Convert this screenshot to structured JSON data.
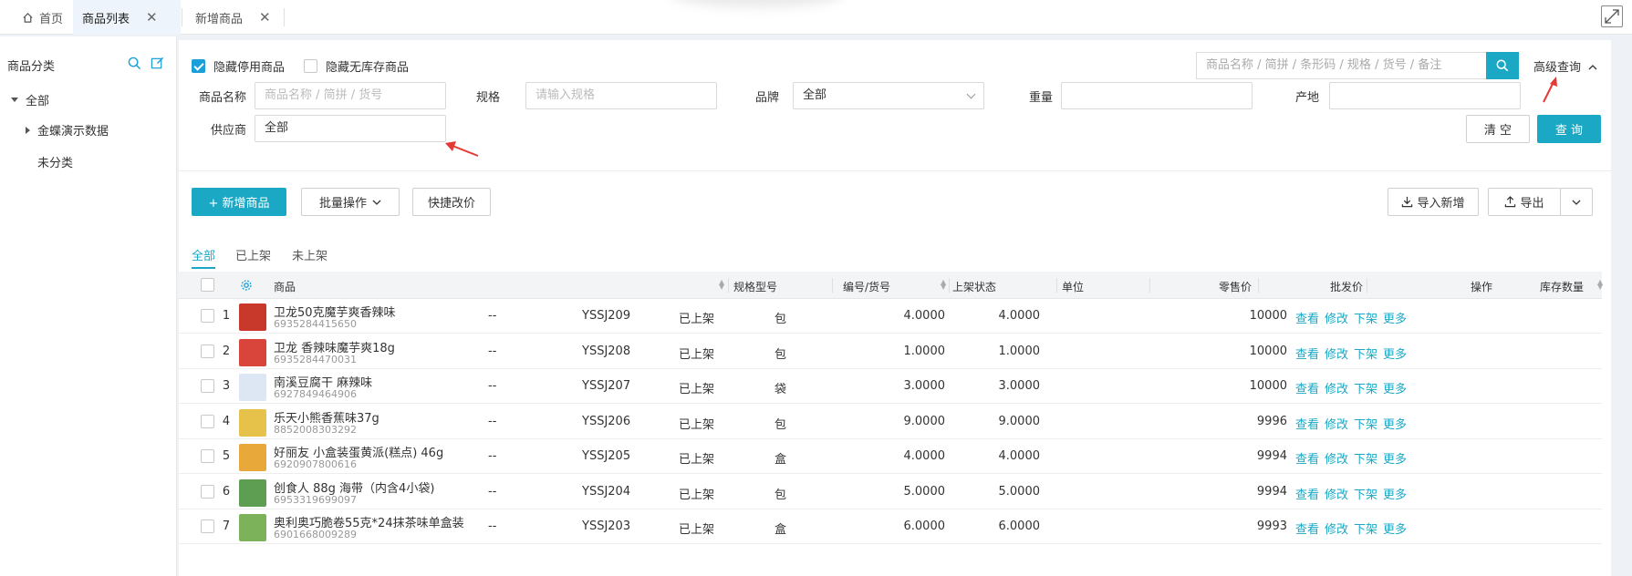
{
  "tabs": [
    {
      "label": "首页",
      "icon": "home-icon"
    },
    {
      "label": "商品列表",
      "closable": true,
      "active": true
    },
    {
      "label": "新增商品",
      "closable": true
    }
  ],
  "sidebar": {
    "title": "商品分类",
    "tree": [
      {
        "label": "全部",
        "expanded": true
      },
      {
        "label": "金蝶演示数据",
        "expanded": false
      },
      {
        "label": "未分类"
      }
    ]
  },
  "filters": {
    "hide_disabled": {
      "label": "隐藏停用商品",
      "checked": true
    },
    "hide_no_stock": {
      "label": "隐藏无库存商品",
      "checked": false
    },
    "search_placeholder": "商品名称 / 简拼 / 条形码 / 规格 / 货号 / 备注",
    "advanced_label": "高级查询",
    "fields": {
      "name_label": "商品名称",
      "name_placeholder": "商品名称 / 简拼 / 货号",
      "spec_label": "规格",
      "spec_placeholder": "请输入规格",
      "brand_label": "品牌",
      "brand_value": "全部",
      "weight_label": "重量",
      "origin_label": "产地",
      "supplier_label": "供应商",
      "supplier_value": "全部"
    },
    "clear_label": "清 空",
    "query_label": "查 询"
  },
  "toolbar": {
    "add_label": "+ 新增商品",
    "batch_label": "批量操作",
    "quick_price_label": "快捷改价",
    "import_label": "导入新增",
    "export_label": "导出"
  },
  "status_tabs": [
    "全部",
    "已上架",
    "未上架"
  ],
  "table": {
    "headers": {
      "product": "商品",
      "spec": "规格型号",
      "code": "编号/货号",
      "status": "上架状态",
      "unit": "单位",
      "retail": "零售价",
      "wholesale": "批发价",
      "stock": "库存数量",
      "ops": "操作"
    },
    "ops": [
      "查看",
      "修改",
      "下架",
      "更多"
    ],
    "rows": [
      {
        "idx": "1",
        "name": "卫龙50克魔芋爽香辣味",
        "barcode": "6935284415650",
        "spec": "--",
        "code": "YSSJ209",
        "status": "已上架",
        "unit": "包",
        "retail": "4.0000",
        "wholesale": "4.0000",
        "stock": "10000",
        "thumb_color": "#c9392b"
      },
      {
        "idx": "2",
        "name": "卫龙 香辣味魔芋爽18g",
        "barcode": "6935284470031",
        "spec": "--",
        "code": "YSSJ208",
        "status": "已上架",
        "unit": "包",
        "retail": "1.0000",
        "wholesale": "1.0000",
        "stock": "10000",
        "thumb_color": "#d9453a"
      },
      {
        "idx": "3",
        "name": "南溪豆腐干 麻辣味",
        "barcode": "6927849464906",
        "spec": "--",
        "code": "YSSJ207",
        "status": "已上架",
        "unit": "袋",
        "retail": "3.0000",
        "wholesale": "3.0000",
        "stock": "10000",
        "thumb_color": "#dde6f3"
      },
      {
        "idx": "4",
        "name": "乐天小熊香蕉味37g",
        "barcode": "8852008303292",
        "spec": "--",
        "code": "YSSJ206",
        "status": "已上架",
        "unit": "包",
        "retail": "9.0000",
        "wholesale": "9.0000",
        "stock": "9996",
        "thumb_color": "#e7c24a"
      },
      {
        "idx": "5",
        "name": "好丽友 小盒装蛋黄派(糕点) 46g",
        "barcode": "6920907800616",
        "spec": "--",
        "code": "YSSJ205",
        "status": "已上架",
        "unit": "盒",
        "retail": "4.0000",
        "wholesale": "4.0000",
        "stock": "9994",
        "thumb_color": "#e8a93a"
      },
      {
        "idx": "6",
        "name": "创食人 88g 海带（内含4小袋)",
        "barcode": "6953319699097",
        "spec": "--",
        "code": "YSSJ204",
        "status": "已上架",
        "unit": "包",
        "retail": "5.0000",
        "wholesale": "5.0000",
        "stock": "9994",
        "thumb_color": "#5e9e52"
      },
      {
        "idx": "7",
        "name": "奥利奥巧脆卷55克*24抹茶味单盒装",
        "barcode": "6901668009289",
        "spec": "--",
        "code": "YSSJ203",
        "status": "已上架",
        "unit": "盒",
        "retail": "6.0000",
        "wholesale": "6.0000",
        "stock": "9993",
        "thumb_color": "#7cb35a"
      }
    ]
  }
}
